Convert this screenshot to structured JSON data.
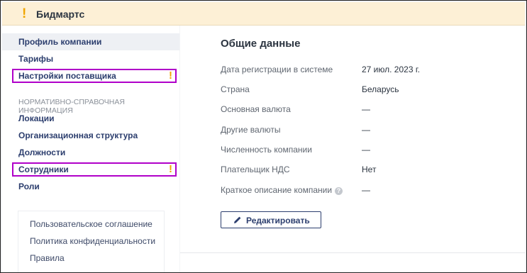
{
  "header": {
    "warning_mark": "!",
    "title": "Бидмартс"
  },
  "sidebar": {
    "items": [
      {
        "label": "Профиль компании",
        "active": true,
        "flag": ""
      },
      {
        "label": "Тарифы",
        "active": false,
        "flag": ""
      },
      {
        "label": "Настройки поставщика",
        "active": false,
        "flag": "!"
      }
    ],
    "section_label": "НОРМАТИВНО-СПРАВОЧНАЯ ИНФОРМАЦИЯ",
    "ref_items": [
      {
        "label": "Локации",
        "flag": ""
      },
      {
        "label": "Организационная структура",
        "flag": ""
      },
      {
        "label": "Должности",
        "flag": ""
      },
      {
        "label": "Сотрудники",
        "flag": "!"
      },
      {
        "label": "Роли",
        "flag": ""
      }
    ],
    "links": [
      "Пользовательское соглашение",
      "Политика конфиденциальности",
      "Правила"
    ]
  },
  "main": {
    "section_title": "Общие данные",
    "rows": [
      {
        "label": "Дата регистрации в системе",
        "value": "27 июл. 2023 г."
      },
      {
        "label": "Страна",
        "value": "Беларусь"
      },
      {
        "label": "Основная валюта",
        "value": "—"
      },
      {
        "label": "Другие валюты",
        "value": "—"
      },
      {
        "label": "Численность компании",
        "value": "—"
      },
      {
        "label": "Плательщик НДС",
        "value": "Нет"
      },
      {
        "label": "Краткое описание компании",
        "value": "—"
      }
    ],
    "help_glyph": "?",
    "edit_button": "Редактировать"
  },
  "colors": {
    "warning": "#f0a500",
    "highlight": "#b000c9",
    "header_bg": "#fdf0d6",
    "nav_text": "#2c3e6e"
  }
}
